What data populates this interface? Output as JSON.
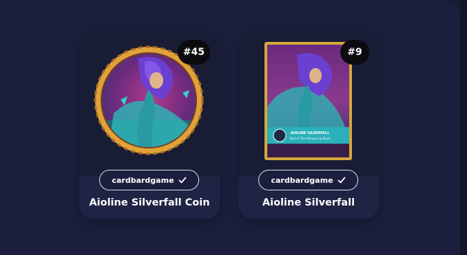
{
  "cards": [
    {
      "number_label": "#45",
      "creator": "cardbardgame",
      "name": "Aioline Silverfall Coin"
    },
    {
      "number_label": "#9",
      "creator": "cardbardgame",
      "name": "Aioline Silverfall",
      "art_caption_title": "AIOLINE SILVERFALL",
      "art_caption_sub": "Bard of The Whispering Wood"
    }
  ],
  "colors": {
    "background": "#1b1f3d",
    "card": "#1f2444",
    "badge": "#0b0b10",
    "coin_rim": "#e0a23a",
    "card_frame": "#d8a83c",
    "art_teal": "#2fb1b4",
    "art_purple": "#6b3fd0"
  },
  "icons": [
    "check-icon"
  ]
}
